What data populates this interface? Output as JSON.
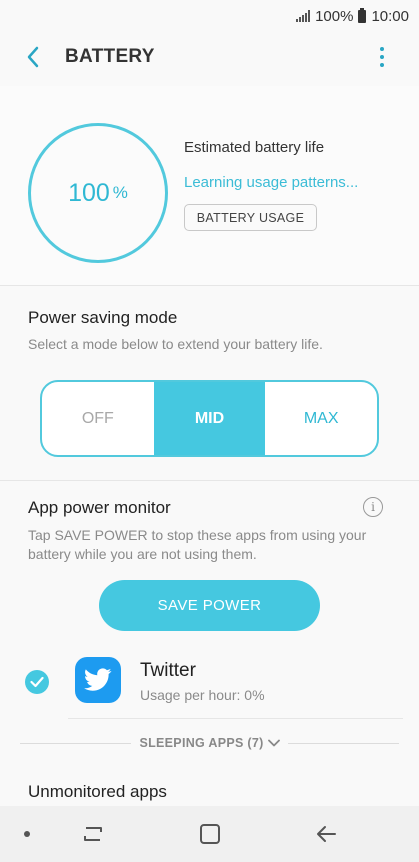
{
  "status_bar": {
    "battery": "100%",
    "time": "10:00"
  },
  "app_bar": {
    "title": "BATTERY"
  },
  "battery_card": {
    "percent_value": "100",
    "percent_unit": "%",
    "estimated_label": "Estimated battery life",
    "learning_label": "Learning usage patterns...",
    "usage_button": "BATTERY USAGE"
  },
  "power_saving": {
    "title": "Power saving mode",
    "subtitle": "Select a mode below to extend your battery life.",
    "modes": [
      "OFF",
      "MID",
      "MAX"
    ],
    "selected": "MID"
  },
  "app_power_monitor": {
    "title": "App power monitor",
    "description": "Tap SAVE POWER to stop these apps from using your battery while you are not using them.",
    "save_button": "SAVE POWER",
    "apps": [
      {
        "name": "Twitter",
        "usage": "Usage per hour: 0%",
        "checked": true
      }
    ],
    "sleeping_label": "SLEEPING APPS (7)"
  },
  "unmonitored": {
    "title": "Unmonitored apps"
  },
  "colors": {
    "accent": "#45c8e0",
    "twitter": "#1d9bf0"
  }
}
